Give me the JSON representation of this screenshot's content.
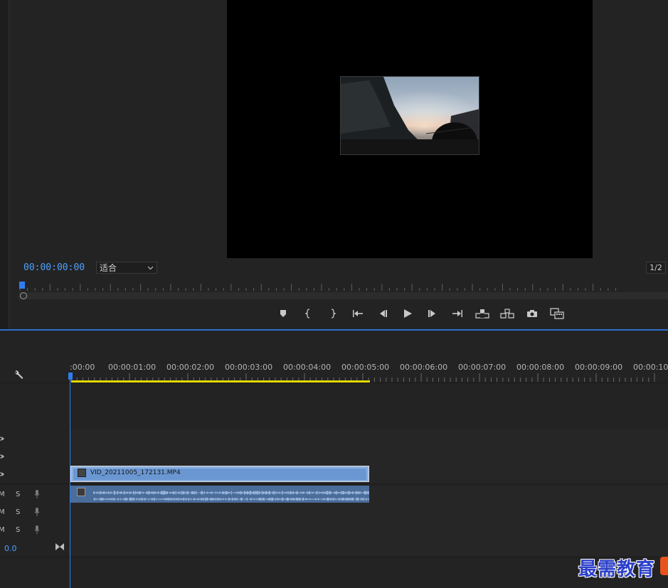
{
  "program_monitor": {
    "timecode": "00:00:00:00",
    "fit_label": "适合",
    "resolution": "1/2",
    "transport_buttons": [
      "add-marker-icon",
      "mark-in-icon",
      "mark-out-icon",
      "go-to-in-icon",
      "step-back-icon",
      "play-icon",
      "step-forward-icon",
      "go-to-out-icon",
      "lift-icon",
      "extract-icon",
      "export-frame-icon",
      "compare-view-icon"
    ]
  },
  "timeline": {
    "ruler_labels": [
      ":00:00",
      "00:00:01:00",
      "00:00:02:00",
      "00:00:03:00",
      "00:00:04:00",
      "00:00:05:00",
      "00:00:06:00",
      "00:00:07:00",
      "00:00:08:00",
      "00:00:09:00",
      "00:00:10:0"
    ],
    "video_tracks": 3,
    "audio_tracks": [
      {
        "m": "M",
        "s": "S"
      },
      {
        "m": "M",
        "s": "S"
      },
      {
        "m": "M",
        "s": "S"
      }
    ],
    "master_volume": "0.0",
    "video_clip_name": "VID_20211005_172131.MP4"
  },
  "watermark": {
    "text": "最需教育"
  },
  "colors": {
    "accent": "#2f7df0",
    "timecode": "#4ea1ff",
    "work_area": "#e3d800",
    "video_clip": "#6a97d2",
    "audio_clip": "#4a6d9a"
  }
}
